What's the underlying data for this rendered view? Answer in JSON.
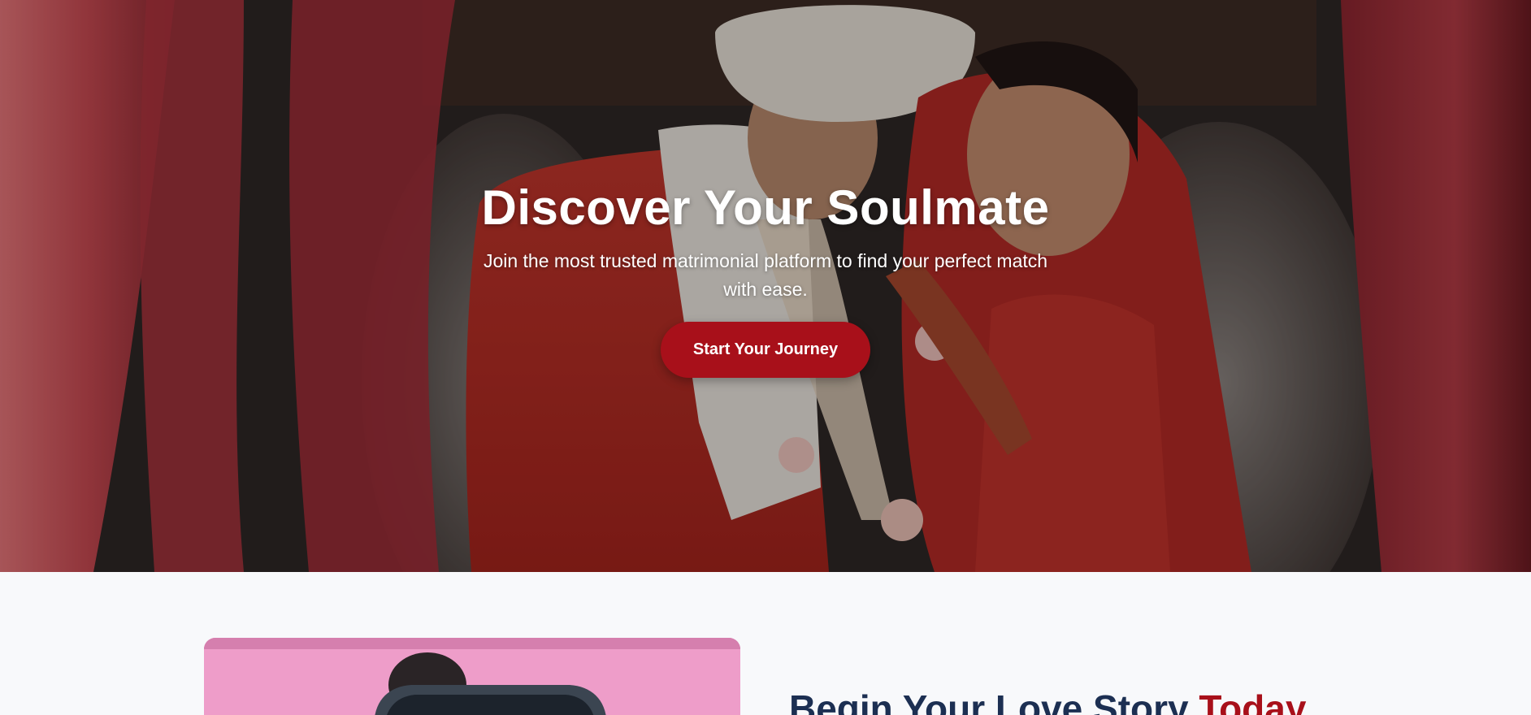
{
  "hero": {
    "title": "Discover Your Soulmate",
    "subtitle": "Join the most trusted matrimonial platform to find your perfect match with ease.",
    "cta_label": "Start Your Journey"
  },
  "about": {
    "heading_main": "Begin Your Love Story",
    "heading_accent": "Today"
  },
  "colors": {
    "brand_red": "#a8101a",
    "heading_navy": "#1c2f52",
    "section_bg": "#f8f9fb"
  }
}
